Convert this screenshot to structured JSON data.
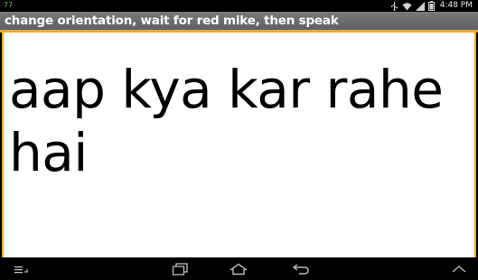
{
  "status_bar": {
    "notification_count": "77",
    "time": "4:48 PM",
    "icons": [
      "usb-icon",
      "wifi-icon",
      "signal-icon",
      "battery-icon"
    ]
  },
  "app": {
    "title": "change orientation, wait for red mike, then speak",
    "recognized_text": "aap kya kar rahe hai",
    "accent_color": "#f5a623"
  },
  "nav_bar": {
    "buttons": [
      "menu-icon",
      "recent-apps-icon",
      "home-icon",
      "back-icon",
      "hide-keyboard-icon"
    ]
  }
}
